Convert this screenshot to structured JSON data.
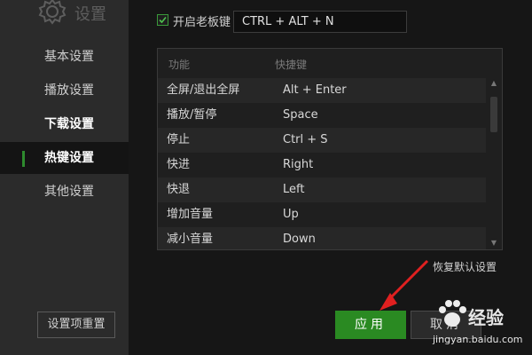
{
  "sidebar": {
    "title": "设置",
    "items": [
      {
        "label": "基本设置"
      },
      {
        "label": "播放设置"
      },
      {
        "label": "下载设置"
      },
      {
        "label": "热键设置"
      },
      {
        "label": "其他设置"
      }
    ],
    "reset_label": "设置项重置"
  },
  "boss_key": {
    "checked": true,
    "label": "开启老板键",
    "value": "CTRL + ALT + N"
  },
  "hotkey_table": {
    "columns": [
      "功能",
      "快捷键"
    ],
    "rows": [
      {
        "function": "全屏/退出全屏",
        "key": "Alt + Enter"
      },
      {
        "function": "播放/暂停",
        "key": "Space"
      },
      {
        "function": "停止",
        "key": "Ctrl + S"
      },
      {
        "function": "快进",
        "key": "Right"
      },
      {
        "function": "快退",
        "key": "Left"
      },
      {
        "function": "增加音量",
        "key": "Up"
      },
      {
        "function": "减小音量",
        "key": "Down"
      }
    ]
  },
  "restore_defaults_label": "恢复默认设置",
  "buttons": {
    "apply_label": "应用",
    "cancel_label": "取消"
  },
  "watermark": {
    "text": "经验",
    "url": "jingyan.baidu.com"
  },
  "colors": {
    "accent_green": "#2a8a22",
    "annotation_arrow": "#e02020"
  }
}
